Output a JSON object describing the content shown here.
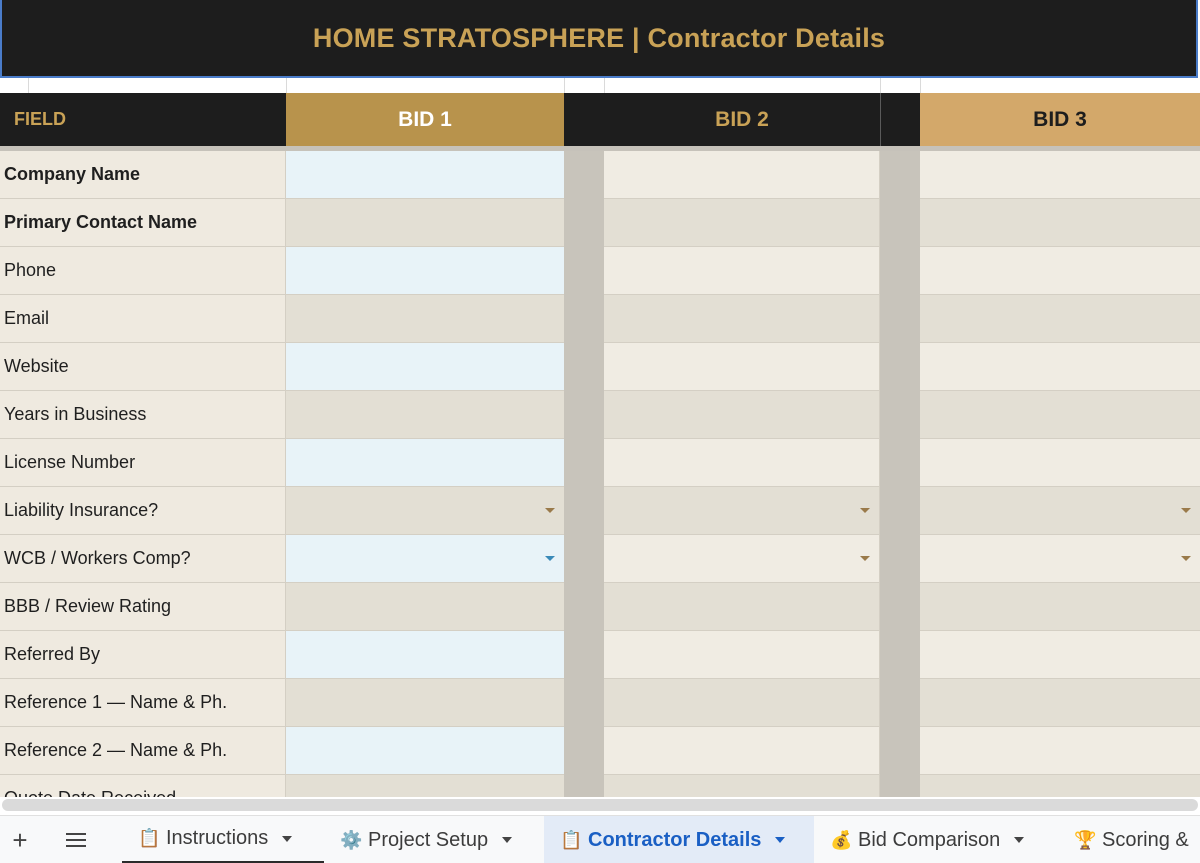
{
  "header": {
    "title": "HOME STRATOSPHERE  |  Contractor Details"
  },
  "columns": {
    "field": "FIELD",
    "bid1": "BID 1",
    "bid2": "BID 2",
    "bid3": "BID 3"
  },
  "rows": [
    {
      "label": "Company Name",
      "bold": true
    },
    {
      "label": "Primary Contact Name",
      "bold": true
    },
    {
      "label": "Phone"
    },
    {
      "label": "Email"
    },
    {
      "label": "Website"
    },
    {
      "label": "Years in Business"
    },
    {
      "label": "License Number"
    },
    {
      "label": "Liability Insurance?",
      "dropdown": true
    },
    {
      "label": "WCB / Workers Comp?",
      "dropdown": true
    },
    {
      "label": "BBB / Review Rating"
    },
    {
      "label": "Referred By"
    },
    {
      "label": "Reference 1 — Name & Ph."
    },
    {
      "label": "Reference 2 — Name & Ph."
    },
    {
      "label": "Quote Date Received"
    }
  ],
  "sheet_tabs": [
    {
      "icon": "📋",
      "label": "Instructions",
      "active": false
    },
    {
      "icon": "⚙️",
      "label": "Project Setup",
      "active": false
    },
    {
      "icon": "📋",
      "label": "Contractor Details",
      "active": true
    },
    {
      "icon": "💰",
      "label": "Bid Comparison",
      "active": false
    },
    {
      "icon": "🏆",
      "label": "Scoring &",
      "active": false
    }
  ],
  "toolbar": {
    "add_icon": "+"
  },
  "colors": {
    "header_bg": "#1d1d1d",
    "gold": "#c9a256",
    "bid1_header": "#b8934c",
    "bid3_header": "#d3a86a",
    "active_tab": "#1a5fc4"
  }
}
